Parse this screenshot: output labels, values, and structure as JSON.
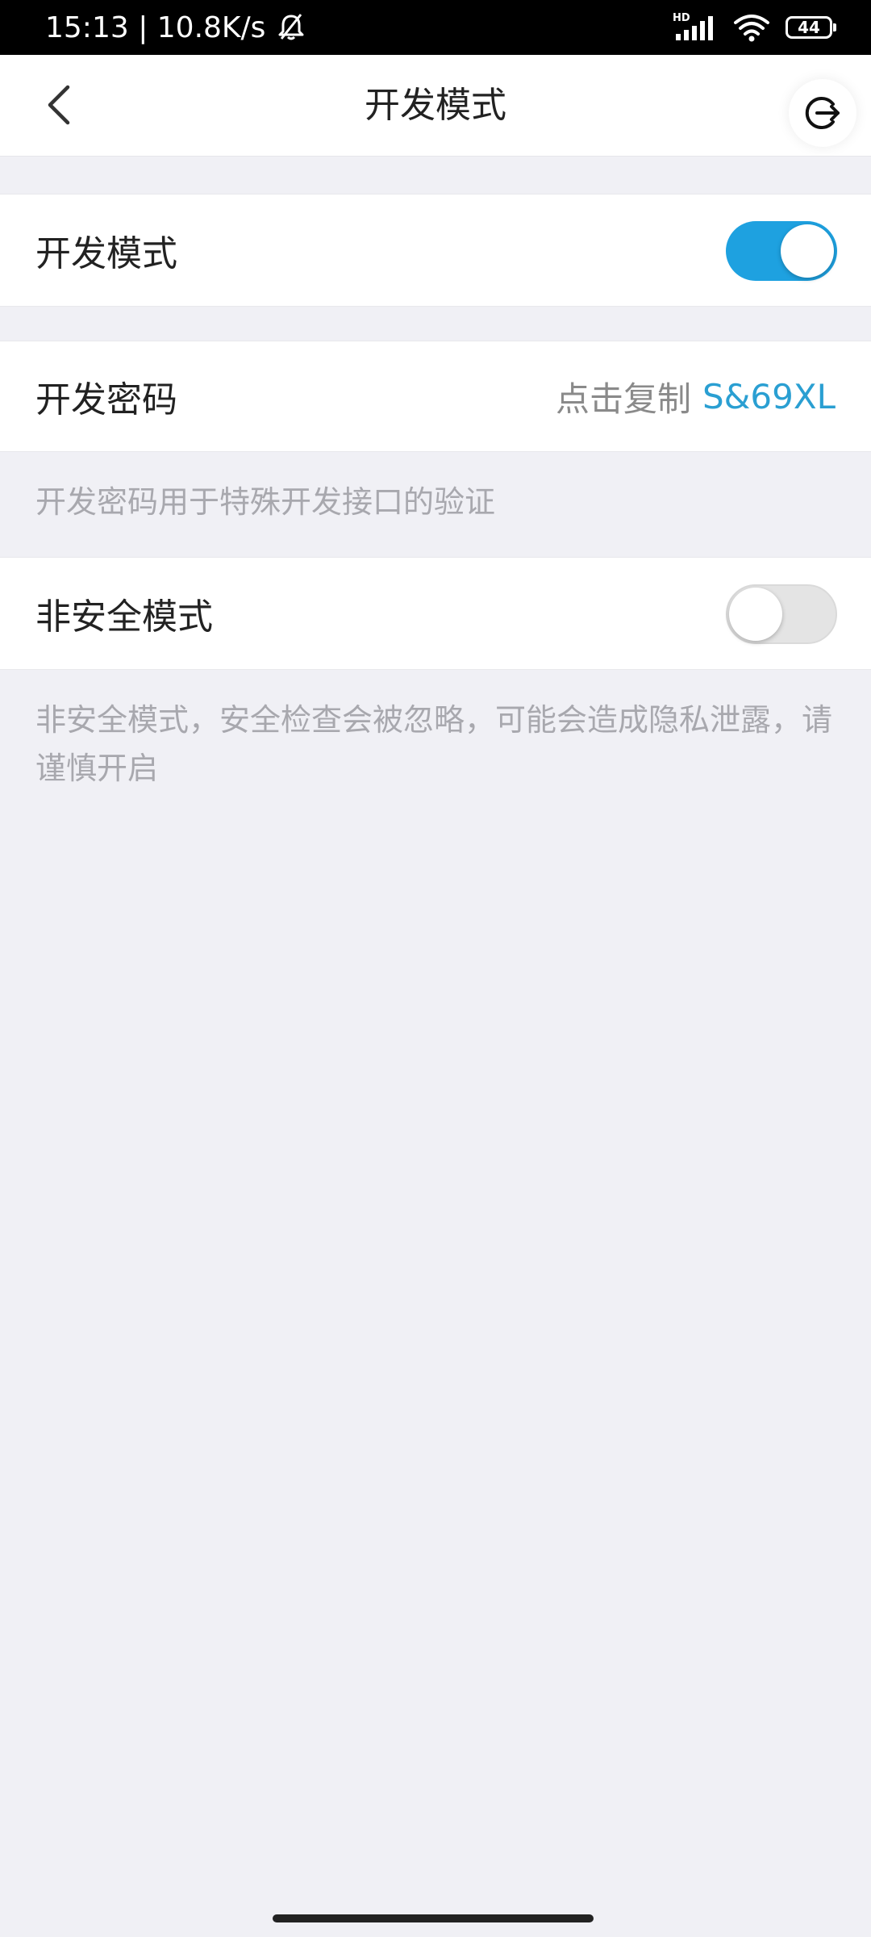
{
  "status_bar": {
    "time_speed": "15:13 | 10.8K/s",
    "network_badge": "HD",
    "battery": "44",
    "icons": [
      "bell-muted-icon",
      "signal-icon",
      "wifi-icon",
      "battery-icon"
    ]
  },
  "nav": {
    "title": "开发模式",
    "back_icon": "chevron-left-icon",
    "exit_icon": "logout-icon"
  },
  "settings": {
    "dev_mode": {
      "label": "开发模式",
      "enabled": true
    },
    "dev_password": {
      "label": "开发密码",
      "hint": "点击复制",
      "code": "S&69XL"
    },
    "dev_password_note": "开发密码用于特殊开发接口的验证",
    "unsafe_mode": {
      "label": "非安全模式",
      "enabled": false
    },
    "unsafe_mode_note": "非安全模式，安全检查会被忽略，可能会造成隐私泄露，请谨慎开启"
  },
  "colors": {
    "accent": "#1ea1e0",
    "code_text": "#2a9fd2",
    "background": "#f0f0f5"
  }
}
